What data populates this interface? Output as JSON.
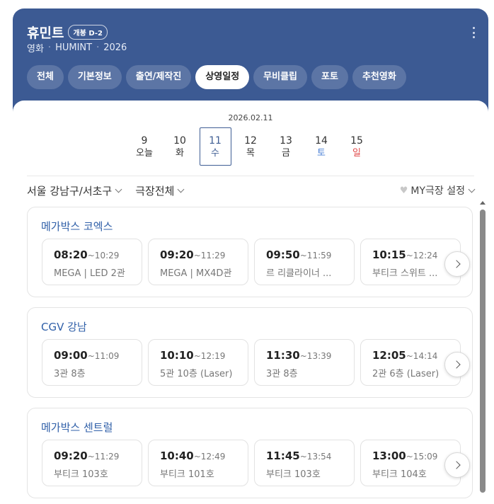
{
  "header": {
    "title": "휴민트",
    "badge": "개봉 D-2",
    "subtitle": [
      "영화",
      "HUMINT",
      "2026"
    ],
    "more_icon": "more-vertical-icon",
    "color": "#3c5a93"
  },
  "tabs": [
    {
      "label": "전체",
      "active": false
    },
    {
      "label": "기본정보",
      "active": false
    },
    {
      "label": "출연/제작진",
      "active": false
    },
    {
      "label": "상영일정",
      "active": true
    },
    {
      "label": "무비클립",
      "active": false
    },
    {
      "label": "포토",
      "active": false
    },
    {
      "label": "추천영화",
      "active": false
    }
  ],
  "schedule": {
    "date_label": "2026.02.11",
    "days": [
      {
        "num": "9",
        "dow": "오늘",
        "selected": false,
        "type": ""
      },
      {
        "num": "10",
        "dow": "화",
        "selected": false,
        "type": ""
      },
      {
        "num": "11",
        "dow": "수",
        "selected": true,
        "type": ""
      },
      {
        "num": "12",
        "dow": "목",
        "selected": false,
        "type": ""
      },
      {
        "num": "13",
        "dow": "금",
        "selected": false,
        "type": ""
      },
      {
        "num": "14",
        "dow": "토",
        "selected": false,
        "type": "sat"
      },
      {
        "num": "15",
        "dow": "일",
        "selected": false,
        "type": "sun"
      }
    ],
    "filters": {
      "region": "서울 강남구/서초구",
      "theater": "극장전체",
      "my_theater": "MY극장 설정"
    }
  },
  "theaters": [
    {
      "name": "메가박스 코엑스",
      "times": [
        {
          "start": "08:20",
          "end": "~10:29",
          "hall": "MEGA | LED 2관"
        },
        {
          "start": "09:20",
          "end": "~11:29",
          "hall": "MEGA | MX4D관"
        },
        {
          "start": "09:50",
          "end": "~11:59",
          "hall": "르 리클라이너 ..."
        },
        {
          "start": "10:15",
          "end": "~12:24",
          "hall": "부티크 스위트 ..."
        }
      ]
    },
    {
      "name": "CGV 강남",
      "times": [
        {
          "start": "09:00",
          "end": "~11:09",
          "hall": "3관 8층"
        },
        {
          "start": "10:10",
          "end": "~12:19",
          "hall": "5관 10층 (Laser)"
        },
        {
          "start": "11:30",
          "end": "~13:39",
          "hall": "3관 8층"
        },
        {
          "start": "12:05",
          "end": "~14:14",
          "hall": "2관 6층 (Laser)"
        }
      ]
    },
    {
      "name": "메가박스 센트럴",
      "times": [
        {
          "start": "09:20",
          "end": "~11:29",
          "hall": "부티크 103호"
        },
        {
          "start": "10:40",
          "end": "~12:49",
          "hall": "부티크 101호"
        },
        {
          "start": "11:45",
          "end": "~13:54",
          "hall": "부티크 103호"
        },
        {
          "start": "13:00",
          "end": "~15:09",
          "hall": "부티크 104호"
        }
      ]
    }
  ]
}
